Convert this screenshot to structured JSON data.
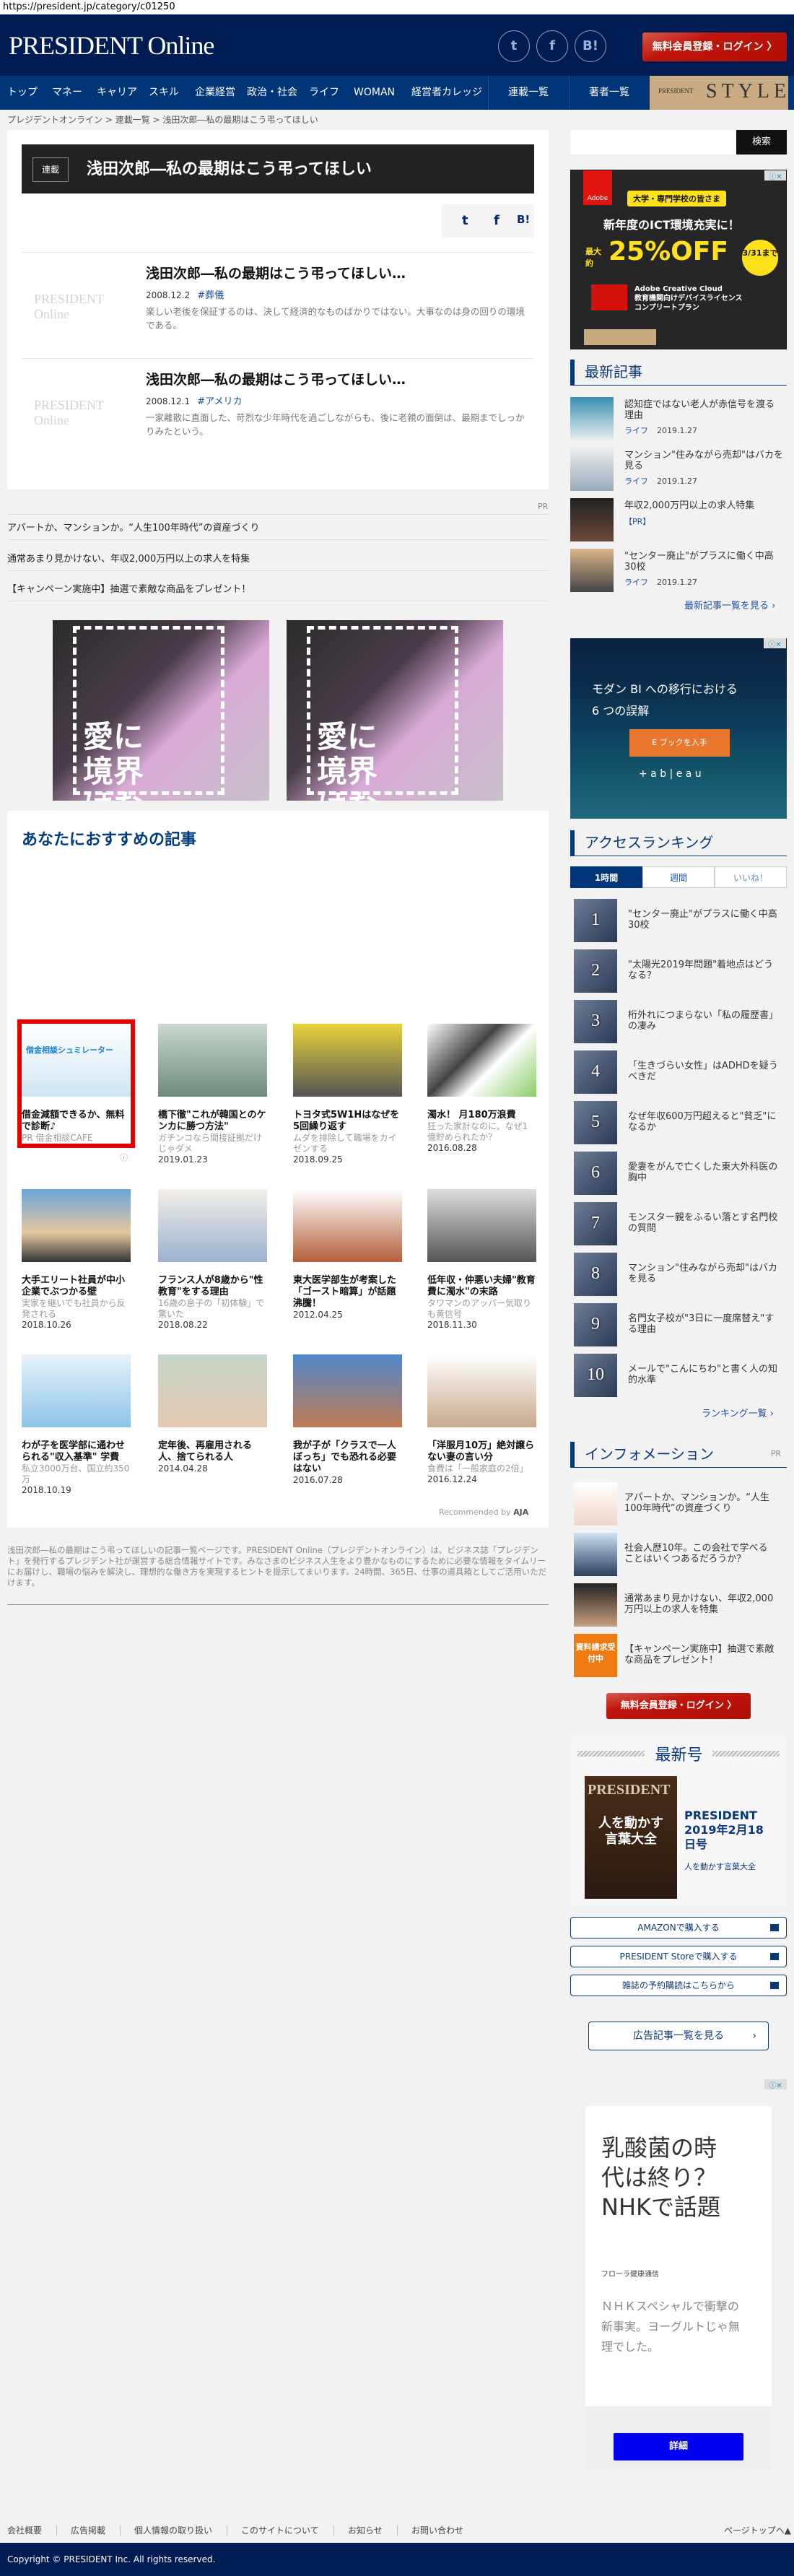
{
  "url": "https://president.jp/category/c01250",
  "header": {
    "logo": "PRESIDENT Online",
    "social": [
      "twitter-icon",
      "facebook-icon",
      "hatena-icon"
    ],
    "hatena_label": "B!",
    "login_label": "無料会員登録・ログイン 〉"
  },
  "nav": {
    "items": [
      "トップ",
      "マネー",
      "キャリア",
      "スキル",
      "企業経営",
      "政治・社会",
      "ライフ",
      "WOMAN",
      "経営者カレッジ"
    ],
    "serial": "連載一覧",
    "authors": "著者一覧",
    "style_small": "PRESIDENT",
    "style_big": "STYLE"
  },
  "breadcrumb": [
    "プレジデントオンライン",
    "連載一覧",
    "浅田次郎―私の最期はこう弔ってほしい"
  ],
  "series": {
    "tag": "連載",
    "title": "浅田次郎―私の最期はこう弔ってほしい",
    "share": {
      "hatena": "B!"
    },
    "placeholder_logo": "PRESIDENT Online",
    "items": [
      {
        "title": "浅田次郎―私の最期はこう弔ってほしい…",
        "date": "2008.12.2",
        "tag": "#葬儀",
        "desc": "楽しい老後を保証するのは、決して経済的なものばかりではない。大事なのは身の回りの環境である。"
      },
      {
        "title": "浅田次郎―私の最期はこう弔ってほしい…",
        "date": "2008.12.1",
        "tag": "#アメリカ",
        "desc": "一家離散に直面した、苛烈な少年時代を過ごしながらも、後に老親の面倒は、最期までしっかりみたという。"
      }
    ]
  },
  "pr": {
    "label": "PR",
    "links": [
      "アパートか、マンションか。“人生100年時代”の資産づくり",
      "通常あまり見かけない、年収2,000万円以上の求人を特集",
      "【キャンペーン実施中】抽選で素敵な商品をプレゼント！"
    ]
  },
  "ads_main": {
    "text": "愛に境界はない"
  },
  "recommend": {
    "heading": "あなたにおすすめの記事",
    "footer": "Recommended by",
    "footer_logo": "AJA",
    "cards": [
      {
        "title": "借金減額できるか、無料で診断♪",
        "desc": "PR 借金相談CAFE",
        "date": "",
        "pr": true,
        "img_title": "借金相談シュミレーター"
      },
      {
        "title": "橋下徹\"これが韓国とのケンカに勝つ方法\"",
        "desc": "ガチンコなら間接証拠だけじゃダメ",
        "date": "2019.01.23"
      },
      {
        "title": "トヨタ式5W1Hはなぜを5回繰り返す",
        "desc": "ムダを排除して職場をカイゼンする",
        "date": "2018.09.25"
      },
      {
        "title": "濁水！ 月180万浪費",
        "desc": "狂った家計なのに、なぜ1億貯められたか？",
        "date": "2016.08.28"
      },
      {
        "title": "大手エリート社員が中小企業でぶつかる壁",
        "desc": "実家を継いでも社員から反発される",
        "date": "2018.10.26"
      },
      {
        "title": "フランス人が8歳から\"性教育\"をする理由",
        "desc": "16歳の息子の「初体験」で驚いた",
        "date": "2018.08.22"
      },
      {
        "title": "東大医学部生が考案した「ゴースト暗算」が話題沸騰！",
        "desc": "",
        "date": "2012.04.25"
      },
      {
        "title": "低年収・仲悪い夫婦\"教育費に濁水\"の末路",
        "desc": "タワマンのアッパー気取りも黄信号",
        "date": "2018.11.30"
      },
      {
        "title": "わが子を医学部に通わせられる\"収入基準\" 学費",
        "desc": "私立3000万台、国立約350万",
        "date": "2018.10.19"
      },
      {
        "title": "定年後、再雇用される人、捨てられる人",
        "desc": "",
        "date": "2014.04.28"
      },
      {
        "title": "我が子が「クラスで一人ぼっち」でも恐れる必要はない",
        "desc": "",
        "date": "2016.07.28"
      },
      {
        "title": "「洋服月10万」絶対譲らない妻の言い分",
        "desc": "食費は「一般家庭の2倍」",
        "date": "2016.12.24"
      }
    ]
  },
  "description": "浅田次郎―私の最期はこう弔ってほしいの記事一覧ページです。PRESIDENT Online（プレジデントオンライン）は、ビジネス誌「プレジデント」を発行するプレジデント社が運営する総合情報サイトです。みなさまのビジネス人生をより豊かなものにするために必要な情報をタイムリーにお届けし、職場の悩みを解決し、理想的な働き方を実現するヒントを提示してまいります。24時間、365日、仕事の道具箱としてご活用いただけます。",
  "sidebar": {
    "search": {
      "placeholder": "",
      "button": "検索"
    },
    "ad_adobe": {
      "brand": "Adobe",
      "badge": "大学・専門学校の皆さま",
      "line1": "新年度のICT環境充実に！",
      "pre": "最大約",
      "big": "25%OFF",
      "until": "3/31まで",
      "product1": "Adobe Creative Cloud",
      "product2": "教育機関向けデバイスライセンス",
      "product3": "コンプリートプラン"
    },
    "latest": {
      "heading": "最新記事",
      "more": "最新記事一覧を見る ›",
      "items": [
        {
          "title": "認知症ではない老人が赤信号を渡る理由",
          "cat": "ライフ",
          "date": "2019.1.27"
        },
        {
          "title": "マンション\"住みながら売却\"はバカを見る",
          "cat": "ライフ",
          "date": "2019.1.27"
        },
        {
          "title": "年収2,000万円以上の求人特集",
          "cat": "【PR】",
          "date": ""
        },
        {
          "title": "\"センター廃止\"がプラスに働く中高30校",
          "cat": "ライフ",
          "date": "2019.1.27"
        }
      ]
    },
    "ad_tableau": {
      "line1": "モダン BI への移行における",
      "line2": "6 つの誤解",
      "cta": "E ブックを入手",
      "brand": "+ a b | e a u"
    },
    "ranking": {
      "heading": "アクセスランキング",
      "tabs": [
        "1時間",
        "週間",
        "いいね！"
      ],
      "more": "ランキング一覧 ›",
      "items": [
        "\"センター廃止\"がプラスに働く中高30校",
        "\"太陽光2019年問題\"着地点はどうなる？",
        "桁外れにつまらない「私の履歴書」の凄み",
        "「生きづらい女性」はADHDを疑うべきだ",
        "なぜ年収600万円超えると\"貧乏\"になるか",
        "愛妻をがんで亡くした東大外科医の胸中",
        "モンスター親をふるい落とす名門校の質問",
        "マンション\"住みながら売却\"はバカを見る",
        "名門女子校が\"3日に一度席替え\"する理由",
        "メールで\"こんにちわ\"と書く人の知的水準"
      ]
    },
    "info": {
      "heading": "インフォメーション",
      "pr": "PR",
      "badge": "資料請求受付中",
      "items": [
        "アパートか、マンションか。“人生100年時代”の資産づくり",
        "社会人歴10年。この会社で学べることはいくつあるだろうか？",
        "通常あまり見かけない、年収2,000万円以上の求人を特集",
        "【キャンペーン実施中】抽選で素敵な商品をプレゼント！"
      ]
    },
    "login_label": "無料会員登録・ログイン 〉",
    "issue": {
      "heading": "最新号",
      "cover_logo": "PRESIDENT",
      "cover_headline": "人を動かす言葉大全",
      "name": "PRESIDENT 2019年2月18日号",
      "subtitle": "人を動かす言葉大全",
      "buttons": [
        "AMAZONで購入する",
        "PRESIDENT Storeで購入する",
        "雑誌の予約購読はこちらから"
      ]
    },
    "ad_articles": "広告記事一覧を見る",
    "ad_nhk": {
      "headline": "乳酸菌の時代は終り？NHKで話題",
      "advertiser": "フローラ健康通信",
      "body": "ＮＨＫスペシャルで衝撃の新事実。ヨーグルトじゃ無理でした。",
      "cta": "詳細"
    }
  },
  "footer": {
    "links": [
      "会社概要",
      "広告掲載",
      "個人情報の取り扱い",
      "このサイトについて",
      "お知らせ",
      "お問い合わせ"
    ],
    "pagetop": "ページトップへ▲",
    "copyright": "Copyright © PRESIDENT Inc. All rights reserved."
  },
  "colors": {
    "navy": "#001c52",
    "nav": "#003578",
    "accent_red": "#b00f06",
    "link_blue": "#1e4fa0"
  }
}
